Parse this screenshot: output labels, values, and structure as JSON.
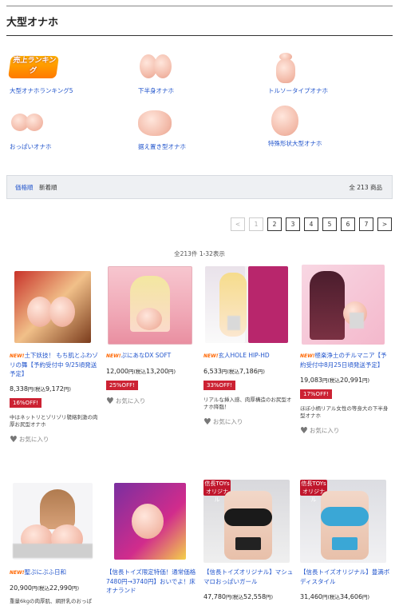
{
  "page_title": "大型オナホ",
  "categories": [
    {
      "label": "大型オナホランキング5",
      "icon": "ranking-badge-icon",
      "badge": "売上ランキング"
    },
    {
      "label": "下半身オナホ",
      "icon": "lower-body-icon"
    },
    {
      "label": "トルソータイプオナホ",
      "icon": "torso-icon"
    },
    {
      "label": "おっぱいオナホ",
      "icon": "breast-icon"
    },
    {
      "label": "据え置き型オナホ",
      "icon": "stationary-icon"
    },
    {
      "label": "特殊形状大型オナホ",
      "icon": "special-shape-icon"
    }
  ],
  "sort": {
    "by_price": "価格順",
    "by_new": "新着順",
    "count": "全 213 商品"
  },
  "pager": {
    "prev": "<",
    "pages": [
      "1",
      "2",
      "3",
      "4",
      "5",
      "6",
      "7"
    ],
    "next": ">"
  },
  "range_text": "全213件 1-32表示",
  "products": [
    {
      "new": "NEW!",
      "name": "土下妖技！ もち肌とふわゾリの舞【予約受付中 9/25頃発送予定】",
      "price": "8,338",
      "tax_price": "9,172",
      "off": "16%OFF!",
      "desc": "中はネットリとゾリゾリ襞絡刺激の肉厚お尻型オナホ",
      "fav": "お気に入り"
    },
    {
      "new": "NEW!",
      "name": "ぷにあなDX SOFT",
      "price": "12,000",
      "tax_price": "13,200",
      "off": "25%OFF!",
      "desc": "",
      "fav": "お気に入り"
    },
    {
      "new": "NEW!",
      "name": "玄人HOLE HIP-HD",
      "price": "6,533",
      "tax_price": "7,186",
      "off": "33%OFF!",
      "desc": "リアルな挿入感、肉厚構造のお尻型オナホ降臨！",
      "fav": "お気に入り"
    },
    {
      "new": "NEW!",
      "name": "極楽浄土のチルマニア【予約受付中8月25日頃発送予定】",
      "price": "19,083",
      "tax_price": "20,991",
      "off": "17%OFF!",
      "desc": "ほぼ小柄リアル女性の等身大の下半身型オナホ",
      "fav": "お気に入り"
    },
    {
      "new": "NEW!",
      "name": "聖ぷにぷふ日和",
      "price": "20,900",
      "tax_price": "22,990",
      "off": "",
      "desc": "重量6kgの肉厚肌、網肝乳のおっぱ",
      "fav": ""
    },
    {
      "new": "",
      "name": "【信長トイズ限定特価！通常価格7480円→3740円】おいでよ！床オナランド",
      "price": "",
      "tax_price": "",
      "off": "",
      "desc": "",
      "fav": ""
    },
    {
      "new": "",
      "name": "【信長トイズオリジナル】マシュマロおっぱいガール",
      "price": "47,780",
      "tax_price": "52,558",
      "off": "",
      "desc": "",
      "fav": ""
    },
    {
      "new": "",
      "name": "【信長トイズオリジナル】豊満ボディスタイル",
      "price": "31,460",
      "tax_price": "34,606",
      "off": "",
      "desc": "",
      "fav": ""
    }
  ],
  "currency": "円",
  "tax_open": "(税込",
  "tax_close": "円)",
  "brand_tag": "信長TOYs",
  "brand_sub": "オリジナル"
}
